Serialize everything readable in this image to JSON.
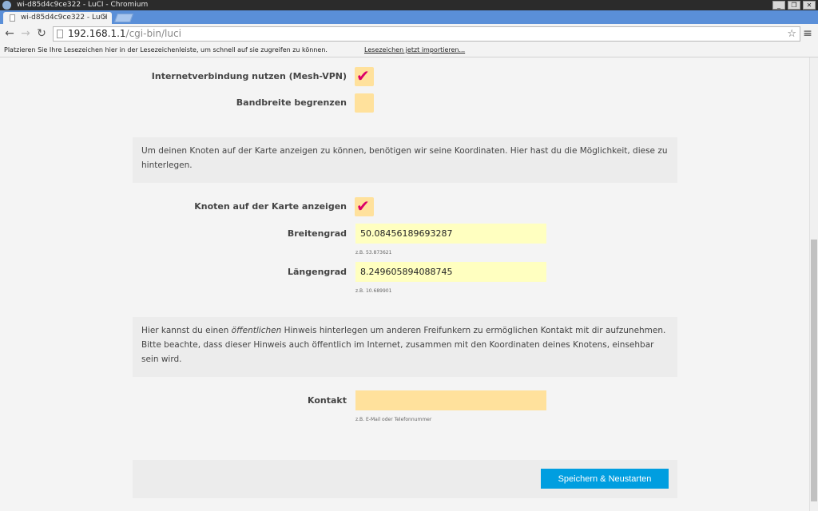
{
  "window": {
    "title": "wi-d85d4c9ce322 - LuCI - Chromium"
  },
  "tab": {
    "title": "wi-d85d4c9ce322 - LuCI",
    "close_glyph": "×"
  },
  "omnibox": {
    "host": "192.168.1.1",
    "path": "/cgi-bin/luci"
  },
  "bookmarks_bar": {
    "text": "Platzieren Sie Ihre Lesezeichen hier in der Lesezeichenleiste, um schnell auf sie zugreifen zu können.",
    "import_link": "Lesezeichen jetzt importieren..."
  },
  "form": {
    "mesh_vpn": {
      "label": "Internetverbindung nutzen (Mesh-VPN)",
      "checked": true
    },
    "bandwidth": {
      "label": "Bandbreite begrenzen",
      "checked": false
    },
    "location_info": "Um deinen Knoten auf der Karte anzeigen zu können, benötigen wir seine Koordinaten. Hier hast du die Möglichkeit, diese zu hinterlegen.",
    "show_on_map": {
      "label": "Knoten auf der Karte anzeigen",
      "checked": true
    },
    "latitude": {
      "label": "Breitengrad",
      "value": "50.08456189693287",
      "hint": "z.B. 53.873621"
    },
    "longitude": {
      "label": "Längengrad",
      "value": "8.249605894088745",
      "hint": "z.B. 10.689901"
    },
    "contact_info": {
      "before": "Hier kannst du einen ",
      "emphasis": "öffentlichen",
      "after": " Hinweis hinterlegen um anderen Freifunkern zu ermöglichen Kontakt mit dir aufzunehmen. Bitte beachte, dass dieser Hinweis auch öffentlich im Internet, zusammen mit den Koordinaten deines Knotens, einsehbar sein wird."
    },
    "contact": {
      "label": "Kontakt",
      "value": "",
      "hint": "z.B. E-Mail oder Telefonnummer"
    },
    "save_button": "Speichern & Neustarten"
  },
  "colors": {
    "checkbox_bg": "#ffe19c",
    "checkmark": "#dc0067",
    "input_bg": "#ffffc0",
    "button_bg": "#009ee0",
    "tabstrip": "#5a8fd8"
  },
  "icons": {
    "back": "arrow-left-icon",
    "forward": "arrow-right-icon",
    "reload": "reload-icon",
    "bookmark": "star-icon",
    "menu": "hamburger-menu-icon",
    "checkmark": "checkmark-icon"
  }
}
